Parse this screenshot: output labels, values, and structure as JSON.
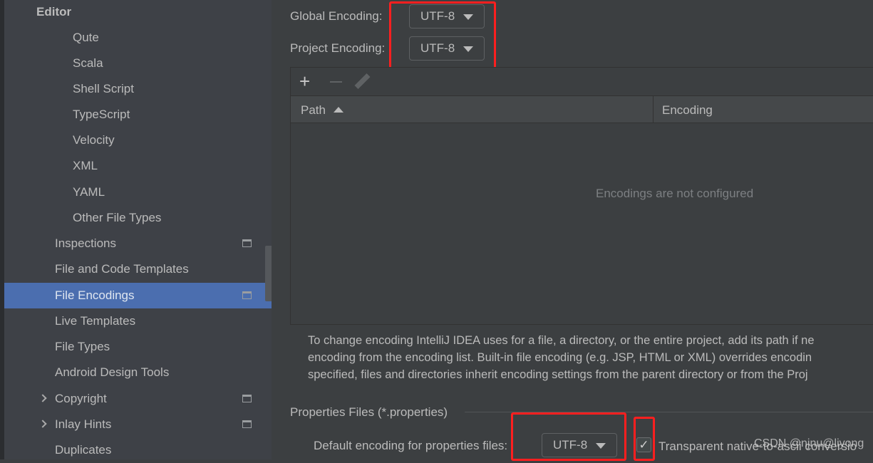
{
  "sidebar": {
    "section": "Editor",
    "items": [
      {
        "label": "Qute"
      },
      {
        "label": "Scala"
      },
      {
        "label": "Shell Script"
      },
      {
        "label": "TypeScript"
      },
      {
        "label": "Velocity"
      },
      {
        "label": "XML"
      },
      {
        "label": "YAML"
      },
      {
        "label": "Other File Types"
      },
      {
        "label": "Inspections"
      },
      {
        "label": "File and Code Templates"
      },
      {
        "label": "File Encodings",
        "selected": true
      },
      {
        "label": "Live Templates"
      },
      {
        "label": "File Types"
      },
      {
        "label": "Android Design Tools"
      },
      {
        "label": "Copyright"
      },
      {
        "label": "Inlay Hints"
      },
      {
        "label": "Duplicates"
      }
    ]
  },
  "main": {
    "global_encoding_label": "Global Encoding:",
    "global_encoding_value": "UTF-8",
    "project_encoding_label": "Project Encoding:",
    "project_encoding_value": "UTF-8",
    "table": {
      "columns": [
        "Path",
        "Encoding"
      ],
      "empty_text": "Encodings are not configured"
    },
    "help_lines": [
      "To change encoding IntelliJ IDEA uses for a file, a directory, or the entire project, add its path if ne",
      "encoding from the encoding list. Built-in file encoding (e.g. JSP, HTML or XML) overrides encodin",
      "specified, files and directories inherit encoding settings from the parent directory or from the Proj"
    ],
    "properties_section": "Properties Files (*.properties)",
    "default_encoding_label": "Default encoding for properties files:",
    "default_encoding_value": "UTF-8",
    "transparent_label": "Transparent native-to-ascii conversio",
    "transparent_checked": true
  },
  "watermark": "CSDN @njnu@liyong",
  "colors": {
    "selection": "#4b6eaf",
    "highlight": "#ff1f1f"
  }
}
